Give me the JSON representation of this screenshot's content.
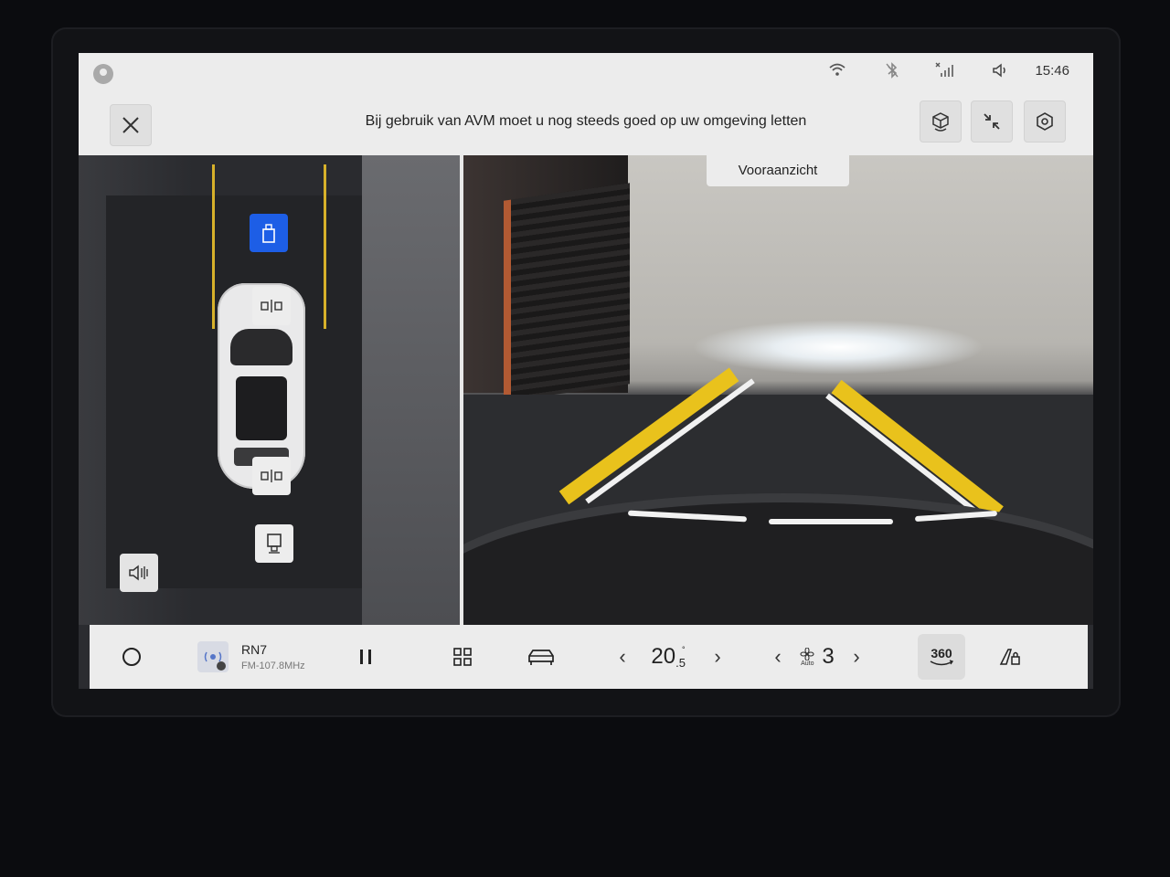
{
  "statusbar": {
    "time": "15:46",
    "icons": [
      "profile-icon",
      "wifi-icon",
      "bluetooth-off-icon",
      "no-signal-icon",
      "volume-icon"
    ]
  },
  "header": {
    "warning": "Bij gebruik van AVM moet u nog steeds goed op uw omgeving letten",
    "buttons": [
      "close-icon",
      "3d-view-icon",
      "minimize-icon",
      "settings-icon"
    ]
  },
  "camera": {
    "view_label": "Vooraanzicht"
  },
  "media": {
    "station": "RN7",
    "frequency": "FM-107.8MHz"
  },
  "climate": {
    "temp_int": "20",
    "temp_dec": ".5",
    "temp_deg": "°",
    "fan_mode": "Auto",
    "fan_speed": "3"
  },
  "bottom": {
    "view360_label": "360"
  },
  "colors": {
    "accent": "#1d5ee6",
    "lane": "#e9c21c",
    "bar": "#ececec"
  }
}
